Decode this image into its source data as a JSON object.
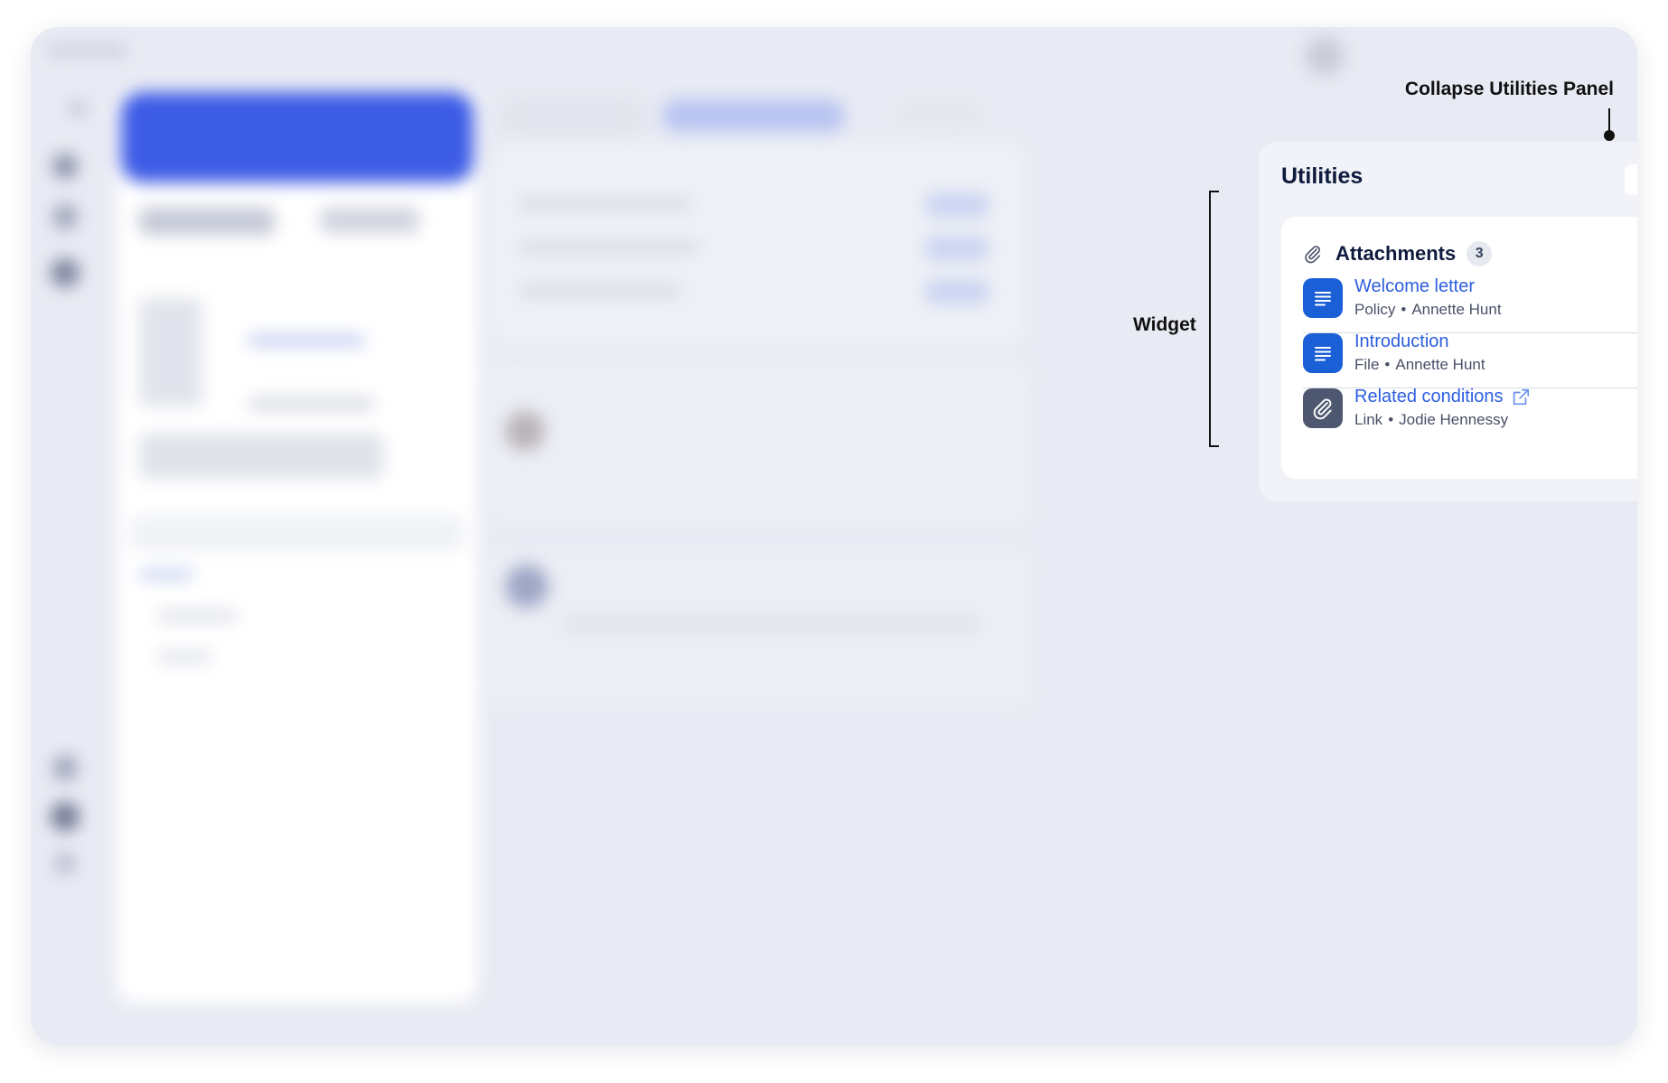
{
  "annotations": {
    "collapse_label": "Collapse Utilities Panel",
    "widget_label": "Widget"
  },
  "utilities": {
    "title": "Utilities",
    "collapse_icon": "caret-right-icon",
    "widget": {
      "title": "Attachments",
      "count": "3",
      "items": [
        {
          "name": "Welcome letter",
          "type": "Policy",
          "separator": "•",
          "author": "Annette Hunt",
          "icon": "document-icon"
        },
        {
          "name": "Introduction",
          "type": "File",
          "separator": "•",
          "author": "Annette Hunt",
          "icon": "document-icon"
        },
        {
          "name": "Related conditions",
          "type": "Link",
          "separator": "•",
          "author": "Jodie Hennessy",
          "icon": "paperclip-icon",
          "external": true
        }
      ]
    }
  },
  "colors": {
    "accent": "#2c5ee0",
    "doc_icon_bg": "#1a5fd6",
    "link_icon_bg": "#4d5770",
    "highlight_card": "#3d5ce6"
  }
}
